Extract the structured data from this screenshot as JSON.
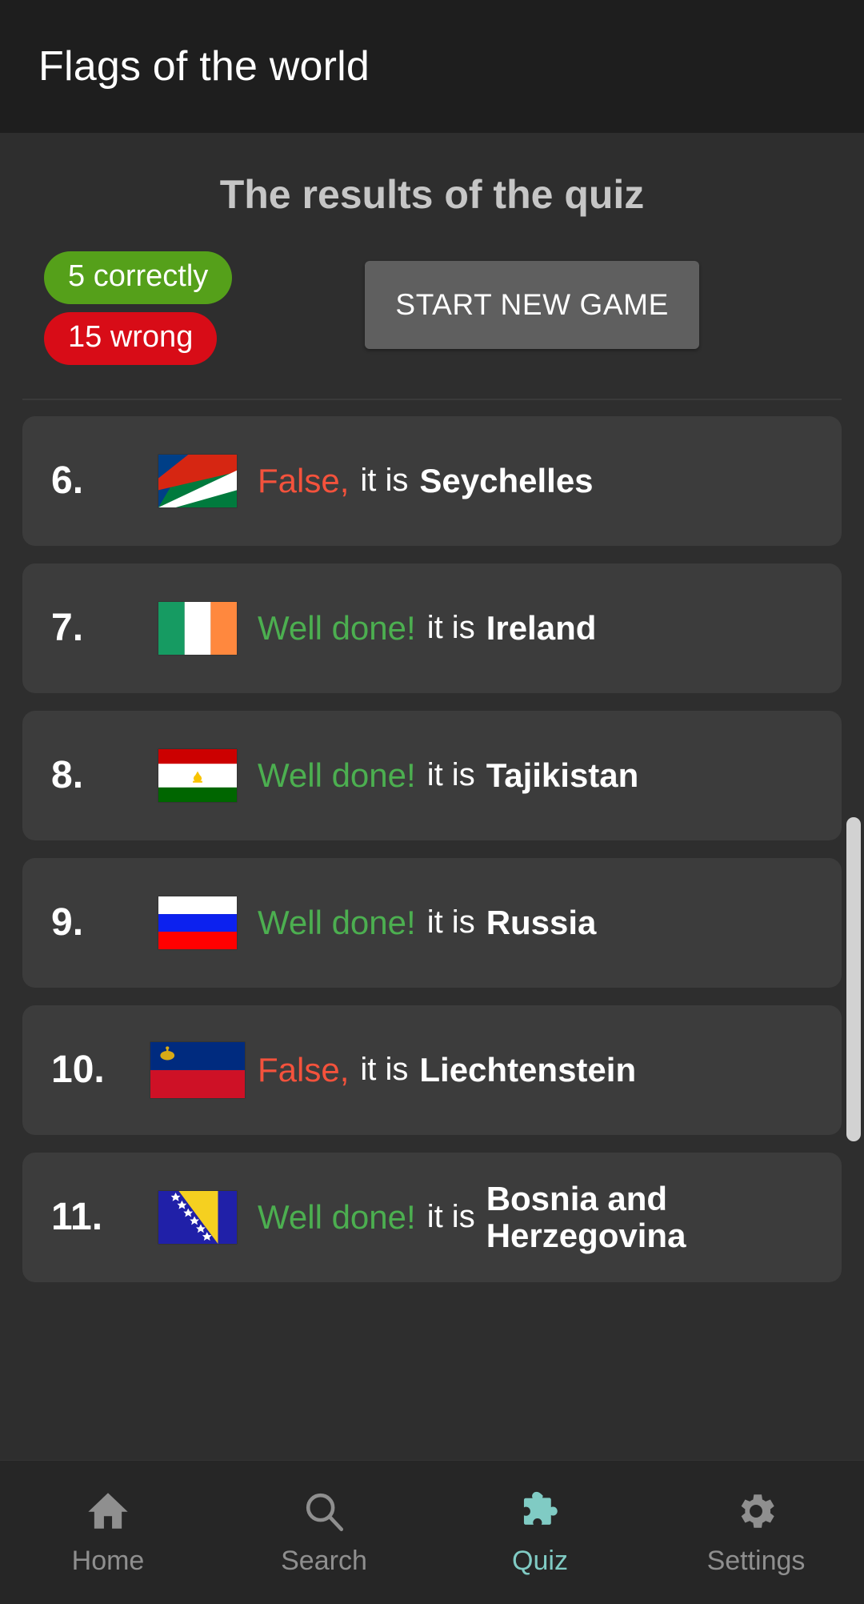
{
  "app": {
    "title": "Flags of the world"
  },
  "results": {
    "heading": "The results of the quiz",
    "correct_badge": "5 correctly",
    "wrong_badge": "15 wrong",
    "new_game_button": "START NEW GAME",
    "correct_color": "#55a01a",
    "wrong_color": "#d80c17",
    "correct_text_color": "#4caf50",
    "false_text_color": "#f4523c"
  },
  "rows": [
    {
      "number": "6.",
      "verdict": "False,",
      "correct": false,
      "connector": "it is",
      "country": "Seychelles",
      "flag": "seychelles"
    },
    {
      "number": "7.",
      "verdict": "Well done!",
      "correct": true,
      "connector": "it is",
      "country": "Ireland",
      "flag": "ireland"
    },
    {
      "number": "8.",
      "verdict": "Well done!",
      "correct": true,
      "connector": "it is",
      "country": "Tajikistan",
      "flag": "tajikistan"
    },
    {
      "number": "9.",
      "verdict": "Well done!",
      "correct": true,
      "connector": "it is",
      "country": "Russia",
      "flag": "russia"
    },
    {
      "number": "10.",
      "verdict": "False,",
      "correct": false,
      "connector": "it is",
      "country": "Liechtenstein",
      "flag": "liechtenstein"
    },
    {
      "number": "11.",
      "verdict": "Well done!",
      "correct": true,
      "connector": "it is",
      "country": "Bosnia and Herzegovina",
      "flag": "bosnia"
    }
  ],
  "bottom_nav": {
    "active": "Quiz",
    "active_color": "#80cbc4",
    "items": [
      {
        "label": "Home",
        "icon": "home-icon"
      },
      {
        "label": "Search",
        "icon": "search-icon"
      },
      {
        "label": "Quiz",
        "icon": "puzzle-piece-icon"
      },
      {
        "label": "Settings",
        "icon": "gear-icon"
      }
    ]
  }
}
